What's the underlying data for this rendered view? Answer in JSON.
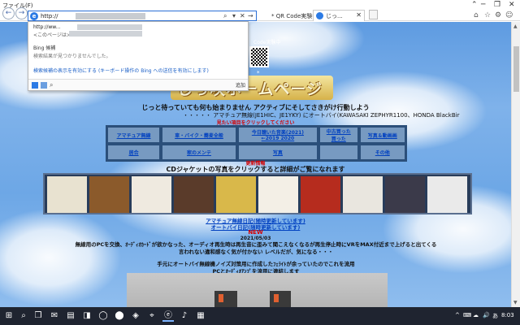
{
  "browser": {
    "address": {
      "url_prefix": "http://",
      "controls": [
        "⌕",
        "▾",
        "✕",
        "→"
      ]
    },
    "tabs": [
      {
        "label": "* QR Code実験中",
        "active": false
      },
      {
        "label": "じっ...",
        "active": true,
        "close": "✕"
      }
    ],
    "window_controls": [
      "⌃",
      "─",
      "❐",
      "✕"
    ],
    "tool_icons": [
      "⌂",
      "☆",
      "⚙",
      "☺"
    ],
    "menu_file": "ファイル(F)"
  },
  "dropdown": {
    "row1": "http://ww...",
    "row2": "<このページは>",
    "bing_label": "Bing 候補",
    "no_results": "検索結果が見つかりませんでした。",
    "enable_link": "検索候補の表示を有効にする (キーボード操作の Bing への送信を有効にします)",
    "goto": "追加"
  },
  "header": {
    "qr_label": "Code実験中",
    "star": "*",
    "banner": "じっ咲ホームページ",
    "motto": "じっと待っていても何も始まりません アクティブにそしてさきがけ行動しよう",
    "amateur": "・・・・・ アマチュア無線(JE1HIC、JE1YKY) にオートバイ(KAWASAKI ZEPHYR1100、HONDA BlackBir",
    "click_hint": "見たい項目をクリックしてください"
  },
  "nav": [
    [
      "アマチュア無線",
      "車・バイク・蕎麦全般",
      "今日聴いた音楽(2021)\n←2019 2020",
      "中古買った\n買った",
      "写真＆動画画"
    ],
    [
      "居合",
      "家のメンテ",
      "写真",
      "",
      "その他"
    ]
  ],
  "updated": "更新情報",
  "cd_hint": "CDジャケットの写真をクリックすると詳細がご覧になれます",
  "cd_covers": [
    {
      "name": "cd-1",
      "color": "#e8e2d0"
    },
    {
      "name": "cd-2",
      "color": "#8b5a2b"
    },
    {
      "name": "cd-3",
      "color": "#efeae0"
    },
    {
      "name": "cd-4",
      "color": "#5a3b2a"
    },
    {
      "name": "cd-5",
      "color": "#d9b84a"
    },
    {
      "name": "cd-6",
      "color": "#f3efe6"
    },
    {
      "name": "cd-7",
      "color": "#b62c1e"
    },
    {
      "name": "cd-8",
      "color": "#e9e6df"
    },
    {
      "name": "cd-9",
      "color": "#3b3a4a"
    },
    {
      "name": "cd-10",
      "color": "#eaeaea"
    }
  ],
  "diary_links": [
    "アマチュア無線日記(随時更新しています)",
    "オートバイ日記(随時更新しています)"
  ],
  "new_label": "NEW",
  "date": "2021/05/03",
  "paragraph1": "無線用のPCを交換、ｵｰﾃﾞｨｵｶｰﾄﾞが欲かなった、オーディオ再生時は再生音に歪みて聞こえなくなるが再生停止時にVRをMAX付近まで上げると出てくる\n言われない違和感なく気が付かない レベルだが、気になる・・・",
  "paragraph2": "手元にオートバイ無線機ノイズ対策用に作成したﾌｪﾗｲﾄが余っていたのでこれを流用\nPCとｵｰﾃﾞｨｵｱﾝﾌﾟを流用に連結します",
  "taskbar": {
    "icons": [
      "⊞",
      "⌕",
      "❒",
      "✉",
      "▤",
      "◨",
      "◯",
      "⬤",
      "◈",
      "⌖",
      "ⓔ",
      "♪",
      "▦"
    ],
    "tray": [
      "^",
      "⌨",
      "☁",
      "🔊",
      "あ",
      "8:03"
    ]
  }
}
